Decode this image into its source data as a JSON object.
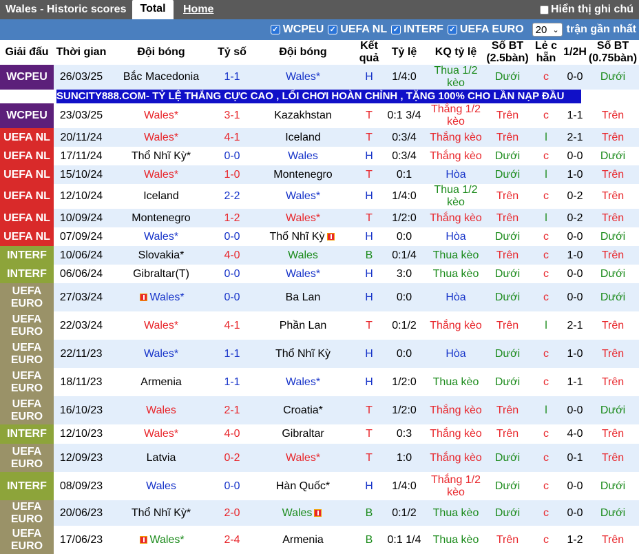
{
  "header": {
    "title": "Wales - Historic scores",
    "tab_total": "Total",
    "tab_home": "Home",
    "handicap_label": "Hiển thị ghi chú"
  },
  "filters": {
    "items": [
      "WCPEU",
      "UEFA NL",
      "INTERF",
      "UEFA EURO"
    ],
    "count": "20",
    "count_label": "trận gần nhất"
  },
  "columns": [
    "Giải đấu",
    "Thời gian",
    "Đội bóng",
    "Tỷ số",
    "Đội bóng",
    "Kết quả",
    "Tỷ lệ",
    "KQ tỷ lệ",
    "Số BT (2.5bàn)",
    "Lẻ c hẵn",
    "1/2H",
    "Số BT (0.75bàn)"
  ],
  "colors": {
    "WCPEU": "#5c1f7a",
    "UEFA NL": "#d92a2a",
    "INTERF": "#8da43a",
    "UEFA EURO": "#9a9268",
    "banner": "#1010c8"
  },
  "banner": "SUNCITY888.COM- TỶ LỆ THẮNG CỰC CAO , LỐI CHƠI HOÀN CHỈNH , TẶNG 100% CHO LẦN NẠP ĐẦU",
  "rows": [
    {
      "league": "WCPEU",
      "league_color": "#5c1f7a",
      "date": "26/03/25",
      "home": "Bắc Macedonia",
      "home_cls": "black",
      "score": "1-1",
      "score_cls": "blue",
      "away": "Wales*",
      "away_cls": "blue",
      "res": "H",
      "res_cls": "blue",
      "odds": "1/4:0",
      "kq": "Thua 1/2 kèo",
      "kq_cls": "green",
      "bt": "Dưới",
      "bt_cls": "green",
      "lc": "c",
      "lc_cls": "red",
      "half": "0-0",
      "bt2": "Dưới",
      "bt2_cls": "green"
    },
    {
      "league": "WCPEU",
      "league_color": "#5c1f7a",
      "date": "23/03/25",
      "home": "Wales*",
      "home_cls": "red",
      "score": "3-1",
      "score_cls": "red",
      "away": "Kazakhstan",
      "away_cls": "black",
      "res": "T",
      "res_cls": "red",
      "odds": "0:1 3/4",
      "kq": "Thắng 1/2 kèo",
      "kq_cls": "red",
      "bt": "Trên",
      "bt_cls": "red",
      "lc": "c",
      "lc_cls": "red",
      "half": "1-1",
      "bt2": "Trên",
      "bt2_cls": "red"
    },
    {
      "league": "UEFA NL",
      "league_color": "#d92a2a",
      "date": "20/11/24",
      "home": "Wales*",
      "home_cls": "red",
      "score": "4-1",
      "score_cls": "red",
      "away": "Iceland",
      "away_cls": "black",
      "res": "T",
      "res_cls": "red",
      "odds": "0:3/4",
      "kq": "Thắng kèo",
      "kq_cls": "red",
      "bt": "Trên",
      "bt_cls": "red",
      "lc": "l",
      "lc_cls": "green",
      "half": "2-1",
      "bt2": "Trên",
      "bt2_cls": "red"
    },
    {
      "league": "UEFA NL",
      "league_color": "#d92a2a",
      "date": "17/11/24",
      "home": "Thổ Nhĩ Kỳ*",
      "home_cls": "black",
      "score": "0-0",
      "score_cls": "blue",
      "away": "Wales",
      "away_cls": "blue",
      "res": "H",
      "res_cls": "blue",
      "odds": "0:3/4",
      "kq": "Thắng kèo",
      "kq_cls": "red",
      "bt": "Dưới",
      "bt_cls": "green",
      "lc": "c",
      "lc_cls": "red",
      "half": "0-0",
      "bt2": "Dưới",
      "bt2_cls": "green"
    },
    {
      "league": "UEFA NL",
      "league_color": "#d92a2a",
      "date": "15/10/24",
      "home": "Wales*",
      "home_cls": "red",
      "score": "1-0",
      "score_cls": "red",
      "away": "Montenegro",
      "away_cls": "black",
      "res": "T",
      "res_cls": "red",
      "odds": "0:1",
      "kq": "Hòa",
      "kq_cls": "blue",
      "bt": "Dưới",
      "bt_cls": "green",
      "lc": "l",
      "lc_cls": "green",
      "half": "1-0",
      "bt2": "Trên",
      "bt2_cls": "red"
    },
    {
      "league": "UEFA NL",
      "league_color": "#d92a2a",
      "date": "12/10/24",
      "home": "Iceland",
      "home_cls": "black",
      "score": "2-2",
      "score_cls": "blue",
      "away": "Wales*",
      "away_cls": "blue",
      "res": "H",
      "res_cls": "blue",
      "odds": "1/4:0",
      "kq": "Thua 1/2 kèo",
      "kq_cls": "green",
      "bt": "Trên",
      "bt_cls": "red",
      "lc": "c",
      "lc_cls": "red",
      "half": "0-2",
      "bt2": "Trên",
      "bt2_cls": "red"
    },
    {
      "league": "UEFA NL",
      "league_color": "#d92a2a",
      "date": "10/09/24",
      "home": "Montenegro",
      "home_cls": "black",
      "score": "1-2",
      "score_cls": "red",
      "away": "Wales*",
      "away_cls": "red",
      "res": "T",
      "res_cls": "red",
      "odds": "1/2:0",
      "kq": "Thắng kèo",
      "kq_cls": "red",
      "bt": "Trên",
      "bt_cls": "red",
      "lc": "l",
      "lc_cls": "green",
      "half": "0-2",
      "bt2": "Trên",
      "bt2_cls": "red"
    },
    {
      "league": "UEFA NL",
      "league_color": "#d92a2a",
      "date": "07/09/24",
      "home": "Wales*",
      "home_cls": "blue",
      "score": "0-0",
      "score_cls": "blue",
      "away": "Thổ Nhĩ Kỳ",
      "away_cls": "black",
      "away_flag": "right",
      "res": "H",
      "res_cls": "blue",
      "odds": "0:0",
      "kq": "Hòa",
      "kq_cls": "blue",
      "bt": "Dưới",
      "bt_cls": "green",
      "lc": "c",
      "lc_cls": "red",
      "half": "0-0",
      "bt2": "Dưới",
      "bt2_cls": "green"
    },
    {
      "league": "INTERF",
      "league_color": "#8da43a",
      "date": "10/06/24",
      "home": "Slovakia*",
      "home_cls": "black",
      "score": "4-0",
      "score_cls": "red",
      "away": "Wales",
      "away_cls": "green",
      "res": "B",
      "res_cls": "green",
      "odds": "0:1/4",
      "kq": "Thua kèo",
      "kq_cls": "green",
      "bt": "Trên",
      "bt_cls": "red",
      "lc": "c",
      "lc_cls": "red",
      "half": "1-0",
      "bt2": "Trên",
      "bt2_cls": "red"
    },
    {
      "league": "INTERF",
      "league_color": "#8da43a",
      "date": "06/06/24",
      "home": "Gibraltar(T)",
      "home_cls": "black",
      "score": "0-0",
      "score_cls": "blue",
      "away": "Wales*",
      "away_cls": "blue",
      "res": "H",
      "res_cls": "blue",
      "odds": "3:0",
      "kq": "Thua kèo",
      "kq_cls": "green",
      "bt": "Dưới",
      "bt_cls": "green",
      "lc": "c",
      "lc_cls": "red",
      "half": "0-0",
      "bt2": "Dưới",
      "bt2_cls": "green"
    },
    {
      "league": "UEFA EURO",
      "league_color": "#9a9268",
      "date": "27/03/24",
      "home": "Wales*",
      "home_cls": "blue",
      "home_flag": "left",
      "score": "0-0",
      "score_cls": "blue",
      "away": "Ba Lan",
      "away_cls": "black",
      "res": "H",
      "res_cls": "blue",
      "odds": "0:0",
      "kq": "Hòa",
      "kq_cls": "blue",
      "bt": "Dưới",
      "bt_cls": "green",
      "lc": "c",
      "lc_cls": "red",
      "half": "0-0",
      "bt2": "Dưới",
      "bt2_cls": "green"
    },
    {
      "league": "UEFA EURO",
      "league_color": "#9a9268",
      "date": "22/03/24",
      "home": "Wales*",
      "home_cls": "red",
      "score": "4-1",
      "score_cls": "red",
      "away": "Phần Lan",
      "away_cls": "black",
      "res": "T",
      "res_cls": "red",
      "odds": "0:1/2",
      "kq": "Thắng kèo",
      "kq_cls": "red",
      "bt": "Trên",
      "bt_cls": "red",
      "lc": "l",
      "lc_cls": "green",
      "half": "2-1",
      "bt2": "Trên",
      "bt2_cls": "red"
    },
    {
      "league": "UEFA EURO",
      "league_color": "#9a9268",
      "date": "22/11/23",
      "home": "Wales*",
      "home_cls": "blue",
      "score": "1-1",
      "score_cls": "blue",
      "away": "Thổ Nhĩ Kỳ",
      "away_cls": "black",
      "res": "H",
      "res_cls": "blue",
      "odds": "0:0",
      "kq": "Hòa",
      "kq_cls": "blue",
      "bt": "Dưới",
      "bt_cls": "green",
      "lc": "c",
      "lc_cls": "red",
      "half": "1-0",
      "bt2": "Trên",
      "bt2_cls": "red"
    },
    {
      "league": "UEFA EURO",
      "league_color": "#9a9268",
      "date": "18/11/23",
      "home": "Armenia",
      "home_cls": "black",
      "score": "1-1",
      "score_cls": "blue",
      "away": "Wales*",
      "away_cls": "blue",
      "res": "H",
      "res_cls": "blue",
      "odds": "1/2:0",
      "kq": "Thua kèo",
      "kq_cls": "green",
      "bt": "Dưới",
      "bt_cls": "green",
      "lc": "c",
      "lc_cls": "red",
      "half": "1-1",
      "bt2": "Trên",
      "bt2_cls": "red"
    },
    {
      "league": "UEFA EURO",
      "league_color": "#9a9268",
      "date": "16/10/23",
      "home": "Wales",
      "home_cls": "red",
      "score": "2-1",
      "score_cls": "red",
      "away": "Croatia*",
      "away_cls": "black",
      "res": "T",
      "res_cls": "red",
      "odds": "1/2:0",
      "kq": "Thắng kèo",
      "kq_cls": "red",
      "bt": "Trên",
      "bt_cls": "red",
      "lc": "l",
      "lc_cls": "green",
      "half": "0-0",
      "bt2": "Dưới",
      "bt2_cls": "green"
    },
    {
      "league": "INTERF",
      "league_color": "#8da43a",
      "date": "12/10/23",
      "home": "Wales*",
      "home_cls": "red",
      "score": "4-0",
      "score_cls": "red",
      "away": "Gibraltar",
      "away_cls": "black",
      "res": "T",
      "res_cls": "red",
      "odds": "0:3",
      "kq": "Thắng kèo",
      "kq_cls": "red",
      "bt": "Trên",
      "bt_cls": "red",
      "lc": "c",
      "lc_cls": "red",
      "half": "4-0",
      "bt2": "Trên",
      "bt2_cls": "red"
    },
    {
      "league": "UEFA EURO",
      "league_color": "#9a9268",
      "date": "12/09/23",
      "home": "Latvia",
      "home_cls": "black",
      "score": "0-2",
      "score_cls": "red",
      "away": "Wales*",
      "away_cls": "red",
      "res": "T",
      "res_cls": "red",
      "odds": "1:0",
      "kq": "Thắng kèo",
      "kq_cls": "red",
      "bt": "Dưới",
      "bt_cls": "green",
      "lc": "c",
      "lc_cls": "red",
      "half": "0-1",
      "bt2": "Trên",
      "bt2_cls": "red"
    },
    {
      "league": "INTERF",
      "league_color": "#8da43a",
      "date": "08/09/23",
      "home": "Wales",
      "home_cls": "blue",
      "score": "0-0",
      "score_cls": "blue",
      "away": "Hàn Quốc*",
      "away_cls": "black",
      "res": "H",
      "res_cls": "blue",
      "odds": "1/4:0",
      "kq": "Thắng 1/2 kèo",
      "kq_cls": "red",
      "bt": "Dưới",
      "bt_cls": "green",
      "lc": "c",
      "lc_cls": "red",
      "half": "0-0",
      "bt2": "Dưới",
      "bt2_cls": "green"
    },
    {
      "league": "UEFA EURO",
      "league_color": "#9a9268",
      "date": "20/06/23",
      "home": "Thổ Nhĩ Kỳ*",
      "home_cls": "black",
      "score": "2-0",
      "score_cls": "red",
      "away": "Wales",
      "away_cls": "green",
      "away_flag": "right",
      "res": "B",
      "res_cls": "green",
      "odds": "0:1/2",
      "kq": "Thua kèo",
      "kq_cls": "green",
      "bt": "Dưới",
      "bt_cls": "green",
      "lc": "c",
      "lc_cls": "red",
      "half": "0-0",
      "bt2": "Dưới",
      "bt2_cls": "green"
    },
    {
      "league": "UEFA EURO",
      "league_color": "#9a9268",
      "date": "17/06/23",
      "home": "Wales*",
      "home_cls": "green",
      "home_flag": "left",
      "score": "2-4",
      "score_cls": "red",
      "away": "Armenia",
      "away_cls": "black",
      "res": "B",
      "res_cls": "green",
      "odds": "0:1 1/4",
      "kq": "Thua kèo",
      "kq_cls": "green",
      "bt": "Trên",
      "bt_cls": "red",
      "lc": "c",
      "lc_cls": "red",
      "half": "1-2",
      "bt2": "Trên",
      "bt2_cls": "red"
    }
  ]
}
